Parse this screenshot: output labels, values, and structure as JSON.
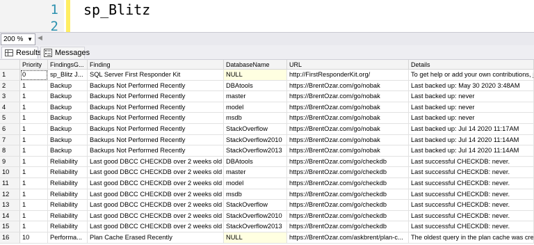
{
  "editor": {
    "line_numbers": [
      "1",
      "2"
    ],
    "code": "sp_Blitz"
  },
  "zoom": {
    "value": "200 %"
  },
  "tabs": {
    "results": "Results",
    "messages": "Messages"
  },
  "grid": {
    "columns": [
      "",
      "Priority",
      "FindingsG...",
      "Finding",
      "DatabaseName",
      "URL",
      "Details"
    ],
    "rows": [
      [
        "1",
        "0",
        "sp_Blitz J...",
        "SQL Server First Responder Kit",
        "NULL",
        "http://FirstResponderKit.org/",
        "To get help or add your own contributions, join"
      ],
      [
        "2",
        "1",
        "Backup",
        "Backups Not Performed Recently",
        "DBAtools",
        "https://BrentOzar.com/go/nobak",
        "Last backed up: May 30 2020  3:48AM"
      ],
      [
        "3",
        "1",
        "Backup",
        "Backups Not Performed Recently",
        "master",
        "https://BrentOzar.com/go/nobak",
        "Last backed up: never"
      ],
      [
        "4",
        "1",
        "Backup",
        "Backups Not Performed Recently",
        "model",
        "https://BrentOzar.com/go/nobak",
        "Last backed up: never"
      ],
      [
        "5",
        "1",
        "Backup",
        "Backups Not Performed Recently",
        "msdb",
        "https://BrentOzar.com/go/nobak",
        "Last backed up: never"
      ],
      [
        "6",
        "1",
        "Backup",
        "Backups Not Performed Recently",
        "StackOverflow",
        "https://BrentOzar.com/go/nobak",
        "Last backed up: Jul 14 2020 11:17AM"
      ],
      [
        "7",
        "1",
        "Backup",
        "Backups Not Performed Recently",
        "StackOverflow2010",
        "https://BrentOzar.com/go/nobak",
        "Last backed up: Jul 14 2020 11:14AM"
      ],
      [
        "8",
        "1",
        "Backup",
        "Backups Not Performed Recently",
        "StackOverflow2013",
        "https://BrentOzar.com/go/nobak",
        "Last backed up: Jul 14 2020 11:14AM"
      ],
      [
        "9",
        "1",
        "Reliability",
        "Last good DBCC CHECKDB over 2 weeks old",
        "DBAtools",
        "https://BrentOzar.com/go/checkdb",
        "Last successful CHECKDB: never."
      ],
      [
        "10",
        "1",
        "Reliability",
        "Last good DBCC CHECKDB over 2 weeks old",
        "master",
        "https://BrentOzar.com/go/checkdb",
        "Last successful CHECKDB: never."
      ],
      [
        "11",
        "1",
        "Reliability",
        "Last good DBCC CHECKDB over 2 weeks old",
        "model",
        "https://BrentOzar.com/go/checkdb",
        "Last successful CHECKDB: never."
      ],
      [
        "12",
        "1",
        "Reliability",
        "Last good DBCC CHECKDB over 2 weeks old",
        "msdb",
        "https://BrentOzar.com/go/checkdb",
        "Last successful CHECKDB: never."
      ],
      [
        "13",
        "1",
        "Reliability",
        "Last good DBCC CHECKDB over 2 weeks old",
        "StackOverflow",
        "https://BrentOzar.com/go/checkdb",
        "Last successful CHECKDB: never."
      ],
      [
        "14",
        "1",
        "Reliability",
        "Last good DBCC CHECKDB over 2 weeks old",
        "StackOverflow2010",
        "https://BrentOzar.com/go/checkdb",
        "Last successful CHECKDB: never."
      ],
      [
        "15",
        "1",
        "Reliability",
        "Last good DBCC CHECKDB over 2 weeks old",
        "StackOverflow2013",
        "https://BrentOzar.com/go/checkdb",
        "Last successful CHECKDB: never."
      ],
      [
        "16",
        "10",
        "Performa...",
        "Plan Cache Erased Recently",
        "NULL",
        "https://BrentOzar.com/askbrent/plan-c...",
        "The oldest query in the plan cache was creat"
      ]
    ]
  }
}
